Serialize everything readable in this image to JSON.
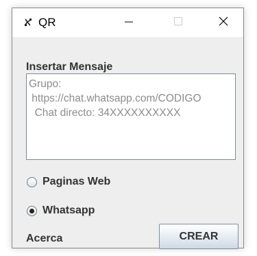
{
  "window": {
    "title": "QR"
  },
  "form": {
    "heading": "Insertar Mensaje",
    "message_placeholder": "Grupo:\n https://chat.whatsapp.com/CODIGO\n  Chat directo: 34XXXXXXXXXX",
    "options": [
      {
        "label": "Paginas Web",
        "checked": false
      },
      {
        "label": "Whatsapp",
        "checked": true
      }
    ],
    "about_label": "Acerca",
    "create_label": "CREAR"
  },
  "colors": {
    "client_background": "#eeeeee",
    "placeholder_text": "#8c8c8c",
    "label_text": "#333333"
  },
  "icons": {
    "app": "qr-app-icon",
    "minimize": "minimize-icon",
    "maximize": "maximize-icon",
    "close": "close-icon"
  }
}
